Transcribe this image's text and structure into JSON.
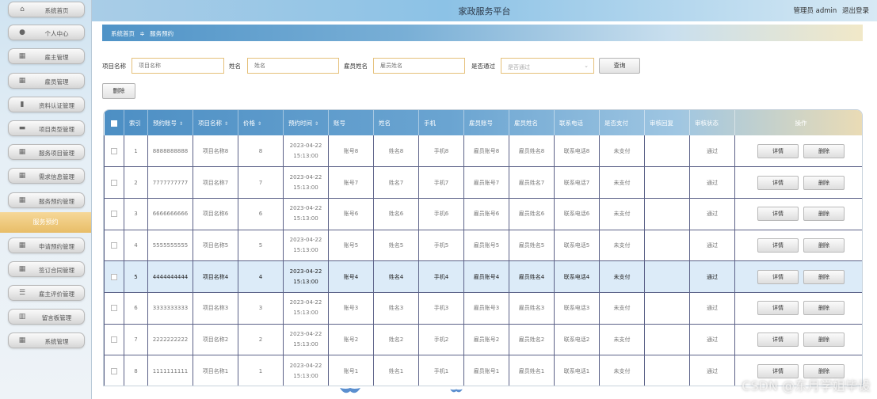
{
  "app": {
    "title": "家政服务平台"
  },
  "header": {
    "user": "管理员 admin",
    "logout": "退出登录"
  },
  "sidebar": {
    "items": [
      {
        "label": "系统首页",
        "icon": "home-icon",
        "glyph": "⌂"
      },
      {
        "label": "个人中心",
        "icon": "user-icon",
        "glyph": "●"
      },
      {
        "label": "雇主管理",
        "icon": "grid-icon",
        "glyph": "▦"
      },
      {
        "label": "雇员管理",
        "icon": "grid-icon",
        "glyph": "▦"
      },
      {
        "label": "资料认证管理",
        "icon": "chart-icon",
        "glyph": "▮"
      },
      {
        "label": "项目类型管理",
        "icon": "card-icon",
        "glyph": "▬"
      },
      {
        "label": "服务项目管理",
        "icon": "grid-icon",
        "glyph": "▦"
      },
      {
        "label": "需求信息管理",
        "icon": "grid-icon",
        "glyph": "▦"
      },
      {
        "label": "服务预约管理",
        "icon": "grid-icon",
        "glyph": "▦"
      },
      {
        "label": "申请预约管理",
        "icon": "grid-icon",
        "glyph": "▦"
      },
      {
        "label": "签订合同管理",
        "icon": "grid-icon",
        "glyph": "▦"
      },
      {
        "label": "雇主评价管理",
        "icon": "list-icon",
        "glyph": "☰"
      },
      {
        "label": "留言板管理",
        "icon": "bar-chart-icon",
        "glyph": "▥"
      },
      {
        "label": "系统管理",
        "icon": "grid-icon",
        "glyph": "▦"
      }
    ],
    "active_sub": "服务预约"
  },
  "breadcrumb": {
    "home": "系统首页",
    "sep": "≑",
    "current": "服务预约"
  },
  "search": {
    "project_label": "项目名称",
    "project_placeholder": "项目名称",
    "name_label": "姓名",
    "name_placeholder": "姓名",
    "staff_label": "雇员姓名",
    "staff_placeholder": "雇员姓名",
    "pass_label": "是否通过",
    "pass_placeholder": "是否通过",
    "query_button": "查询"
  },
  "toolbar": {
    "delete_button": "删除"
  },
  "table": {
    "columns": [
      "索引",
      "预约账号",
      "项目名称",
      "价格",
      "预约时间",
      "账号",
      "姓名",
      "手机",
      "雇员账号",
      "雇员姓名",
      "联系电话",
      "是否支付",
      "审核回复",
      "审核状态",
      "操作"
    ],
    "detail_label": "详情",
    "delete_label": "删除",
    "rows": [
      {
        "idx": "1",
        "acct": "8888888888",
        "project": "项目名称8",
        "price": "8",
        "date": "2023-04-22",
        "time": "15:13:00",
        "user": "账号8",
        "name": "姓名8",
        "phone": "手机8",
        "staff_acct": "雇员账号8",
        "staff_name": "雇员姓名8",
        "tel": "联系电话8",
        "paid": "未支付",
        "reply": "",
        "status": "通过"
      },
      {
        "idx": "2",
        "acct": "7777777777",
        "project": "项目名称7",
        "price": "7",
        "date": "2023-04-22",
        "time": "15:13:00",
        "user": "账号7",
        "name": "姓名7",
        "phone": "手机7",
        "staff_acct": "雇员账号7",
        "staff_name": "雇员姓名7",
        "tel": "联系电话7",
        "paid": "未支付",
        "reply": "",
        "status": "通过"
      },
      {
        "idx": "3",
        "acct": "6666666666",
        "project": "项目名称6",
        "price": "6",
        "date": "2023-04-22",
        "time": "15:13:00",
        "user": "账号6",
        "name": "姓名6",
        "phone": "手机6",
        "staff_acct": "雇员账号6",
        "staff_name": "雇员姓名6",
        "tel": "联系电话6",
        "paid": "未支付",
        "reply": "",
        "status": "通过"
      },
      {
        "idx": "4",
        "acct": "5555555555",
        "project": "项目名称5",
        "price": "5",
        "date": "2023-04-22",
        "time": "15:13:00",
        "user": "账号5",
        "name": "姓名5",
        "phone": "手机5",
        "staff_acct": "雇员账号5",
        "staff_name": "雇员姓名5",
        "tel": "联系电话5",
        "paid": "未支付",
        "reply": "",
        "status": "通过"
      },
      {
        "idx": "5",
        "acct": "4444444444",
        "project": "项目名称4",
        "price": "4",
        "date": "2023-04-22",
        "time": "15:13:00",
        "user": "账号4",
        "name": "姓名4",
        "phone": "手机4",
        "staff_acct": "雇员账号4",
        "staff_name": "雇员姓名4",
        "tel": "联系电话4",
        "paid": "未支付",
        "reply": "",
        "status": "通过"
      },
      {
        "idx": "6",
        "acct": "3333333333",
        "project": "项目名称3",
        "price": "3",
        "date": "2023-04-22",
        "time": "15:13:00",
        "user": "账号3",
        "name": "姓名3",
        "phone": "手机3",
        "staff_acct": "雇员账号3",
        "staff_name": "雇员姓名3",
        "tel": "联系电话3",
        "paid": "未支付",
        "reply": "",
        "status": "通过"
      },
      {
        "idx": "7",
        "acct": "2222222222",
        "project": "项目名称2",
        "price": "2",
        "date": "2023-04-22",
        "time": "15:13:00",
        "user": "账号2",
        "name": "姓名2",
        "phone": "手机2",
        "staff_acct": "雇员账号2",
        "staff_name": "雇员姓名2",
        "tel": "联系电话2",
        "paid": "未支付",
        "reply": "",
        "status": "通过"
      },
      {
        "idx": "8",
        "acct": "1111111111",
        "project": "项目名称1",
        "price": "1",
        "date": "2023-04-22",
        "time": "15:13:00",
        "user": "账号1",
        "name": "姓名1",
        "phone": "手机1",
        "staff_acct": "雇员账号1",
        "staff_name": "雇员姓名1",
        "tel": "联系电话1",
        "paid": "未支付",
        "reply": "",
        "status": "通过"
      }
    ]
  },
  "watermark": "CSDN @东月学姐毕设",
  "colors": {
    "header": "#8cc2e6",
    "breadcrumb": "#4f93c7",
    "active_menu": "#e8bd67",
    "input_border": "#e5c07a",
    "table_head": "#4d8fc4",
    "row_highlight": "#dcebf8"
  }
}
